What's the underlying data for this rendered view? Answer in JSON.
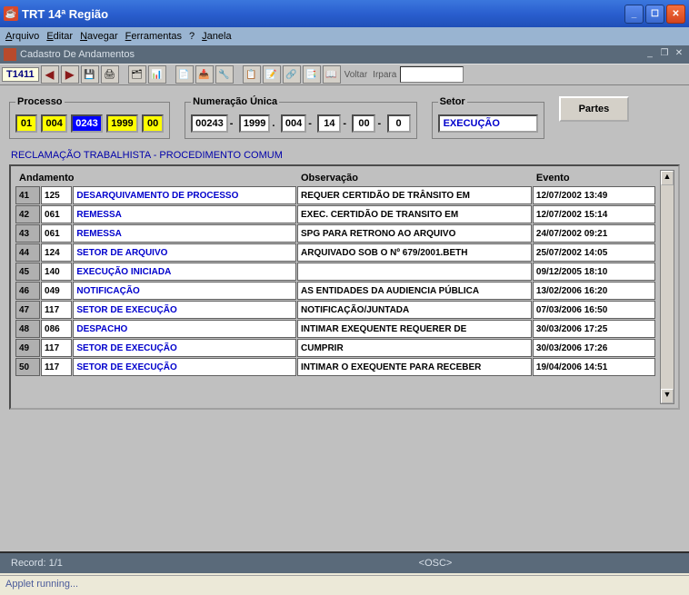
{
  "window": {
    "title": "TRT 14ª Região"
  },
  "menu": {
    "arquivo": "Arquivo",
    "editar": "Editar",
    "navegar": "Navegar",
    "ferramentas": "Ferramentas",
    "ajuda": "?",
    "janela": "Janela"
  },
  "mdi": {
    "title": "Cadastro De Andamentos"
  },
  "toolbar": {
    "tab": "T1411",
    "voltar": "Voltar",
    "irpara": "Irpara"
  },
  "form": {
    "processo_legend": "Processo",
    "processo_parts": [
      "01",
      "004",
      "0243",
      "1999",
      "00"
    ],
    "numeracao_legend": "Numeração Única",
    "numeracao_parts": [
      "00243",
      "1999",
      "004",
      "14",
      "00",
      "0"
    ],
    "setor_legend": "Setor",
    "setor_value": "EXECUÇÃO",
    "partes_btn": "Partes",
    "class_line": "RECLAMAÇÃO TRABALHISTA - PROCEDIMENTO COMUM"
  },
  "grid": {
    "headers": {
      "andamento": "Andamento",
      "observacao": "Observação",
      "evento": "Evento"
    },
    "rows": [
      {
        "idx": "41",
        "code": "125",
        "desc": "DESARQUIVAMENTO DE PROCESSO",
        "obs": "REQUER CERTIDÃO DE TRÂNSITO EM",
        "evt": "12/07/2002 13:49"
      },
      {
        "idx": "42",
        "code": "061",
        "desc": "REMESSA",
        "obs": "EXEC. CERTIDÃO DE TRANSITO EM",
        "evt": "12/07/2002 15:14"
      },
      {
        "idx": "43",
        "code": "061",
        "desc": "REMESSA",
        "obs": "SPG PARA RETRONO AO ARQUIVO",
        "evt": "24/07/2002 09:21"
      },
      {
        "idx": "44",
        "code": "124",
        "desc": "SETOR DE ARQUIVO",
        "obs": "ARQUIVADO SOB O Nº 679/2001.BETH",
        "evt": "25/07/2002 14:05"
      },
      {
        "idx": "45",
        "code": "140",
        "desc": "EXECUÇÃO INICIADA",
        "obs": "",
        "evt": "09/12/2005 18:10"
      },
      {
        "idx": "46",
        "code": "049",
        "desc": "NOTIFICAÇÃO",
        "obs": "AS ENTIDADES DA AUDIENCIA PÚBLICA",
        "evt": "13/02/2006 16:20"
      },
      {
        "idx": "47",
        "code": "117",
        "desc": "SETOR DE EXECUÇÃO",
        "obs": "NOTIFICAÇÃO/JUNTADA",
        "evt": "07/03/2006 16:50"
      },
      {
        "idx": "48",
        "code": "086",
        "desc": "DESPACHO",
        "obs": "INTIMAR EXEQUENTE REQUERER DE",
        "evt": "30/03/2006 17:25"
      },
      {
        "idx": "49",
        "code": "117",
        "desc": "SETOR DE EXECUÇÃO",
        "obs": "CUMPRIR",
        "evt": "30/03/2006 17:26"
      },
      {
        "idx": "50",
        "code": "117",
        "desc": "SETOR DE EXECUÇÃO",
        "obs": "INTIMAR O EXEQUENTE PARA RECEBER",
        "evt": "19/04/2006 14:51"
      }
    ]
  },
  "status": {
    "record": "Record: 1/1",
    "osc": "<OSC>"
  },
  "applet": "Applet running..."
}
